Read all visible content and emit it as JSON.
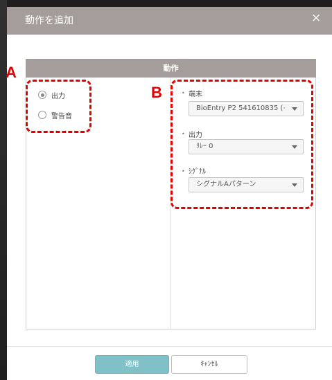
{
  "dialog": {
    "title": "動作を追加",
    "close_glyph": "×",
    "panel_title": "動作"
  },
  "radios": [
    {
      "label": "出力",
      "selected": true
    },
    {
      "label": "警告音",
      "selected": false
    }
  ],
  "fields": {
    "device": {
      "label": "端末",
      "value": "BioEntry P2 541610835 (⋯"
    },
    "output": {
      "label": "出力",
      "value": "ﾘﾚｰ 0"
    },
    "signal": {
      "label": "ｼｸﾞﾅﾙ",
      "value": "シグナルAパターン"
    }
  },
  "annotations": {
    "a": "A",
    "b": "B"
  },
  "buttons": {
    "apply": "適用",
    "cancel": "ｷｬﾝｾﾙ"
  },
  "colors": {
    "titlebar": "#a49d9b",
    "apply": "#7fc1c7",
    "annotation": "#e00000"
  },
  "icons": {
    "close": "close-icon",
    "dropdown": "chevron-down-icon",
    "bullet": "bullet-icon"
  }
}
